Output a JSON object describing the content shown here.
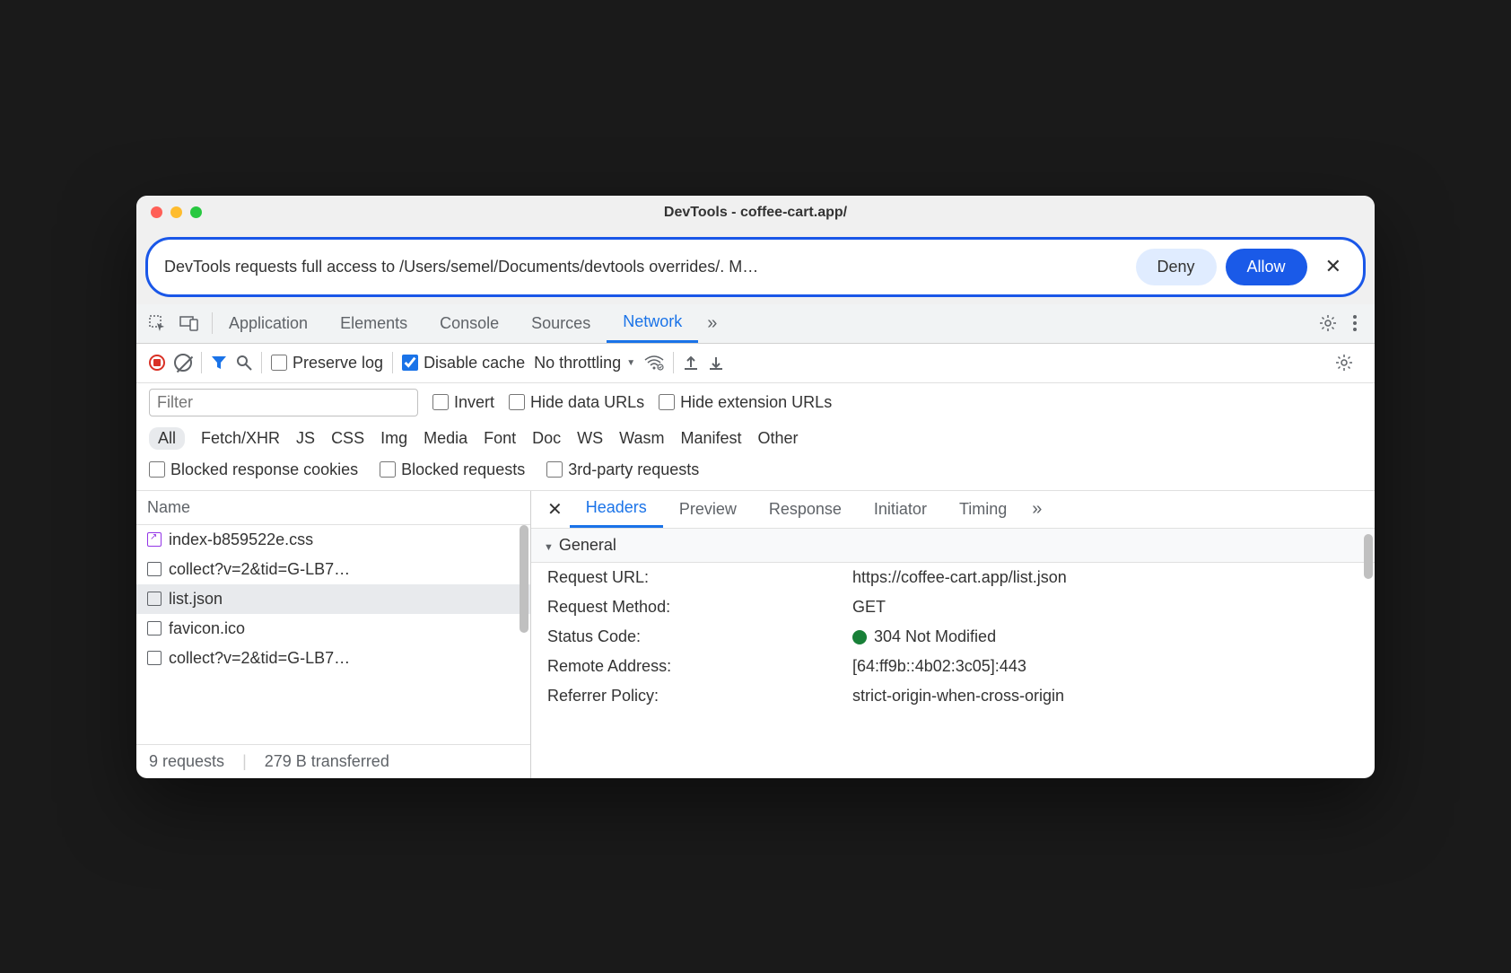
{
  "title": "DevTools - coffee-cart.app/",
  "banner": {
    "text": "DevTools requests full access to /Users/semel/Documents/devtools overrides/. M…",
    "deny": "Deny",
    "allow": "Allow"
  },
  "tabs": [
    "Application",
    "Elements",
    "Console",
    "Sources",
    "Network"
  ],
  "active_tab": "Network",
  "toolbar": {
    "preserve_log": "Preserve log",
    "disable_cache": "Disable cache",
    "throttling": "No throttling"
  },
  "filter": {
    "placeholder": "Filter",
    "invert": "Invert",
    "hide_data": "Hide data URLs",
    "hide_ext": "Hide extension URLs"
  },
  "types": [
    "All",
    "Fetch/XHR",
    "JS",
    "CSS",
    "Img",
    "Media",
    "Font",
    "Doc",
    "WS",
    "Wasm",
    "Manifest",
    "Other"
  ],
  "blocked": {
    "cookies": "Blocked response cookies",
    "requests": "Blocked requests",
    "third": "3rd-party requests"
  },
  "name_header": "Name",
  "files": [
    {
      "name": "index-b859522e.css",
      "type": "css"
    },
    {
      "name": "collect?v=2&tid=G-LB7…",
      "type": "doc"
    },
    {
      "name": "list.json",
      "type": "doc",
      "selected": true
    },
    {
      "name": "favicon.ico",
      "type": "doc"
    },
    {
      "name": "collect?v=2&tid=G-LB7…",
      "type": "doc"
    }
  ],
  "status": {
    "requests": "9 requests",
    "transferred": "279 B transferred"
  },
  "detail_tabs": [
    "Headers",
    "Preview",
    "Response",
    "Initiator",
    "Timing"
  ],
  "active_detail": "Headers",
  "general": {
    "header": "General",
    "rows": [
      {
        "k": "Request URL:",
        "v": "https://coffee-cart.app/list.json"
      },
      {
        "k": "Request Method:",
        "v": "GET"
      },
      {
        "k": "Status Code:",
        "v": "304 Not Modified",
        "dot": true
      },
      {
        "k": "Remote Address:",
        "v": "[64:ff9b::4b02:3c05]:443"
      },
      {
        "k": "Referrer Policy:",
        "v": "strict-origin-when-cross-origin"
      }
    ]
  }
}
